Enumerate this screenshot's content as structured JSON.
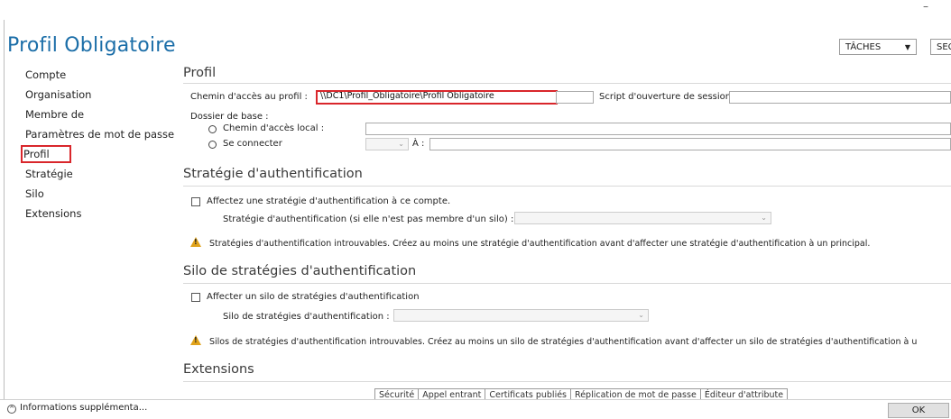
{
  "window": {
    "title": "Profil Obligatoire",
    "minimize": "–",
    "tasks_label": "TÂCHES",
    "sections_label": "SEC"
  },
  "nav": {
    "items": [
      "Compte",
      "Organisation",
      "Membre de",
      "Paramètres de mot de passe",
      "Profil",
      "Stratégie",
      "Silo",
      "Extensions"
    ],
    "active": "Profil"
  },
  "profil": {
    "title": "Profil",
    "path_label": "Chemin d'accès au profil :",
    "path_value": "\\\\DC1\\Profil_Obligatoire\\Profil Obligatoire",
    "script_label": "Script d'ouverture de session",
    "home_folder_label": "Dossier de base :",
    "local_path_label": "Chemin d'accès local :",
    "connect_label": "Se connecter",
    "to_label": "À :"
  },
  "auth_policy": {
    "title": "Stratégie d'authentification",
    "assign_label": "Affectez une stratégie d'authentification à ce compte.",
    "policy_label": "Stratégie d'authentification (si elle n'est pas membre d'un silo) :",
    "warning": "Stratégies d'authentification introuvables. Créez au moins une stratégie d'authentification avant d'affecter une stratégie d'authentification à un principal."
  },
  "auth_silo": {
    "title": "Silo de stratégies d'authentification",
    "assign_label": "Affecter un silo de stratégies d'authentification",
    "silo_label": "Silo de stratégies d'authentification :",
    "warning": "Silos de stratégies d'authentification introuvables. Créez au moins un silo de stratégies d'authentification avant d'affecter un silo de stratégies d'authentification à u"
  },
  "extensions": {
    "title": "Extensions",
    "tabs": [
      "Sécurité",
      "Appel entrant",
      "Certificats publiés",
      "Réplication de mot de passe",
      "Éditeur d'attribute"
    ]
  },
  "footer": {
    "more_info": "Informations supplémenta...",
    "ok": "OK"
  },
  "colors": {
    "accent": "#1b6ea8",
    "highlight": "#d9262b",
    "warning": "#e0a21a"
  }
}
